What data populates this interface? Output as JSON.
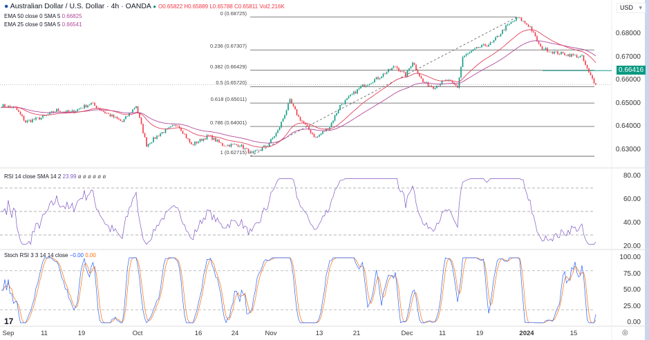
{
  "header": {
    "symbol_title": "Australian Dollar / U.S. Dollar · 4h · OANDA",
    "open": "O0.65822",
    "high": "H0.65889",
    "low": "L0.65788",
    "close": "C0.65811",
    "volume": "Vol2.216K",
    "currency": "USD"
  },
  "indicators": {
    "ema50": {
      "label": "EMA 50 close 0 SMA 5",
      "value": "0.66825"
    },
    "ema25": {
      "label": "EMA 25 close 0 SMA 5",
      "value": "0.66541"
    },
    "rsi": {
      "label": "RSI 14 close SMA 14 2",
      "value": "23.99",
      "extra": "ø ø ø ø ø ø"
    },
    "stoch": {
      "label": "Stoch RSI 3 3 14 14 close",
      "k": "−0.00",
      "d": "0.00"
    }
  },
  "colors": {
    "up": "#089981",
    "down": "#f23645",
    "ema50": "#b0489a",
    "ema25": "#e0435f",
    "rsi": "#7e57c2",
    "stoch_k": "#2962ff",
    "stoch_d": "#ff6d00"
  },
  "price_axis": [
    "0.68000",
    "0.67000",
    "0.66000",
    "0.65000",
    "0.64000",
    "0.63000"
  ],
  "last_price_label": "0.66416",
  "rsi_axis": [
    "80.00",
    "60.00",
    "40.00",
    "20.00"
  ],
  "stoch_axis": [
    "100.00",
    "75.00",
    "50.00",
    "25.00",
    "0.00"
  ],
  "x_axis": [
    "Sep",
    "11",
    "19",
    "Oct",
    "16",
    "24",
    "Nov",
    "13",
    "21",
    "Dec",
    "11",
    "19",
    "2024",
    "15"
  ],
  "fib": [
    {
      "label": "0 (0.68725)",
      "price": 0.68725
    },
    {
      "label": "0.236 (0.67307)",
      "price": 0.67307
    },
    {
      "label": "0.382 (0.66429)",
      "price": 0.66429
    },
    {
      "label": "0.5 (0.65720)",
      "price": 0.6572
    },
    {
      "label": "0.618 (0.65011)",
      "price": 0.65011
    },
    {
      "label": "0.786 (0.64001)",
      "price": 0.64001
    },
    {
      "label": "1 (0.62715)",
      "price": 0.62715
    }
  ],
  "chart_data": {
    "type": "candlestick",
    "title": "Australian Dollar / U.S. Dollar · 4h · OANDA",
    "ylim": [
      0.624,
      0.6885
    ],
    "close_anchors_by_bar": [
      [
        0,
        0.649
      ],
      [
        8,
        0.648
      ],
      [
        14,
        0.642
      ],
      [
        24,
        0.644
      ],
      [
        32,
        0.647
      ],
      [
        40,
        0.646
      ],
      [
        52,
        0.65
      ],
      [
        60,
        0.646
      ],
      [
        70,
        0.642
      ],
      [
        78,
        0.649
      ],
      [
        84,
        0.632
      ],
      [
        92,
        0.637
      ],
      [
        102,
        0.641
      ],
      [
        110,
        0.632
      ],
      [
        120,
        0.636
      ],
      [
        128,
        0.632
      ],
      [
        138,
        0.632
      ],
      [
        145,
        0.628
      ],
      [
        154,
        0.632
      ],
      [
        160,
        0.638
      ],
      [
        167,
        0.651
      ],
      [
        172,
        0.644
      ],
      [
        182,
        0.635
      ],
      [
        190,
        0.64
      ],
      [
        196,
        0.649
      ],
      [
        208,
        0.657
      ],
      [
        218,
        0.661
      ],
      [
        228,
        0.666
      ],
      [
        234,
        0.662
      ],
      [
        238,
        0.668
      ],
      [
        244,
        0.659
      ],
      [
        250,
        0.657
      ],
      [
        258,
        0.66
      ],
      [
        264,
        0.657
      ],
      [
        267,
        0.67
      ],
      [
        276,
        0.674
      ],
      [
        284,
        0.676
      ],
      [
        292,
        0.683
      ],
      [
        299,
        0.687
      ],
      [
        306,
        0.683
      ],
      [
        312,
        0.674
      ],
      [
        320,
        0.672
      ],
      [
        328,
        0.671
      ],
      [
        336,
        0.67
      ],
      [
        340,
        0.663
      ],
      [
        344,
        0.6581
      ]
    ]
  }
}
